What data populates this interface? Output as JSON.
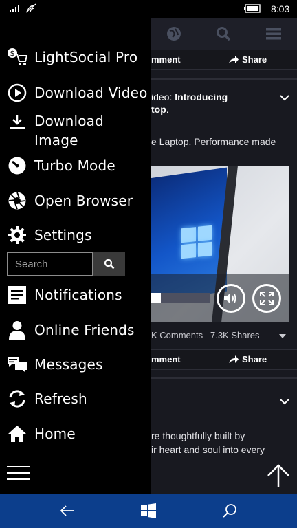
{
  "status_bar": {
    "time": "8:03"
  },
  "menu": {
    "items": [
      {
        "label": "LightSocial Pro",
        "icon": "cart-dollar-icon"
      },
      {
        "label": "Download Video",
        "icon": "play-circle-icon"
      },
      {
        "label": "Download Image",
        "icon": "download-icon"
      },
      {
        "label": "Turbo Mode",
        "icon": "speedometer-icon"
      },
      {
        "label": "Open Browser",
        "icon": "aperture-icon"
      },
      {
        "label": "Settings",
        "icon": "gear-icon"
      },
      {
        "label": "Notifications",
        "icon": "notification-list-icon"
      },
      {
        "label": "Online Friends",
        "icon": "person-icon"
      },
      {
        "label": "Messages",
        "icon": "chat-bubbles-icon"
      },
      {
        "label": "Refresh",
        "icon": "refresh-icon"
      },
      {
        "label": "Home",
        "icon": "home-icon"
      }
    ],
    "search_placeholder": "Search"
  },
  "feed": {
    "action_left": "mment",
    "share_label": "Share",
    "post_title_prefix": "ideo: ",
    "post_title_bold_1": "Introducing",
    "post_title_bold_2": "top",
    "post_title_end": ".",
    "post_desc": "e Laptop. Performance made",
    "video_progress": 0.16,
    "stats_comments": "K Comments",
    "stats_shares": "7.3K Shares",
    "post2_line1": "re thoughtfully built by",
    "post2_line2": "ir heart and soul into every"
  },
  "colors": {
    "drawer_bg": "#000000",
    "content_bg": "#181920",
    "navbar_bg": "#0c3e8c"
  }
}
